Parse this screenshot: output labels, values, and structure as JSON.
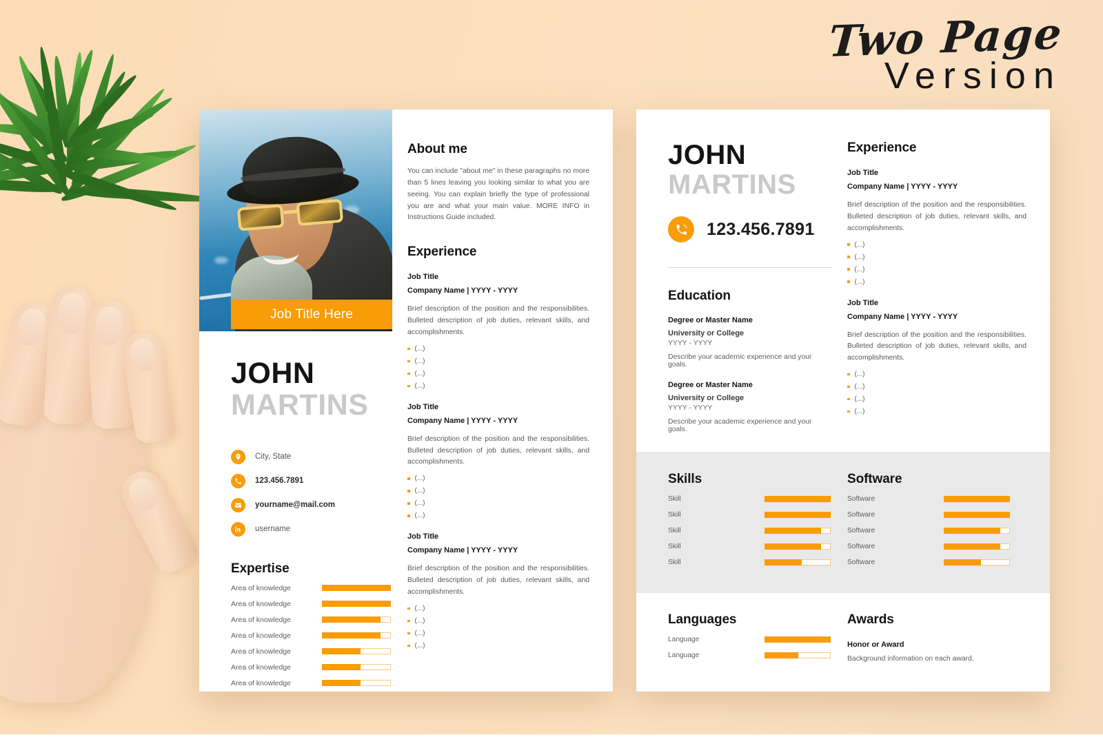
{
  "header": {
    "title_line1": "Two Page",
    "title_line2": "Version"
  },
  "page_one": {
    "photo_alt": "portrait-photo",
    "job_banner": "Job Title Here",
    "name_first": "JOHN",
    "name_last": "MARTINS",
    "contacts": [
      {
        "icon": "location-pin-icon",
        "text": "City, State",
        "bold": false
      },
      {
        "icon": "phone-icon",
        "text": "123.456.7891",
        "bold": true
      },
      {
        "icon": "envelope-icon",
        "text": "yourname@mail.com",
        "bold": true
      },
      {
        "icon": "linkedin-icon",
        "text": "username",
        "bold": false
      }
    ],
    "expertise": {
      "heading": "Expertise",
      "items": [
        {
          "label": "Area of knowledge",
          "value": 100
        },
        {
          "label": "Area of knowledge",
          "value": 100
        },
        {
          "label": "Area of knowledge",
          "value": 85
        },
        {
          "label": "Area of knowledge",
          "value": 85
        },
        {
          "label": "Area of knowledge",
          "value": 55
        },
        {
          "label": "Area of knowledge",
          "value": 55
        },
        {
          "label": "Area of knowledge",
          "value": 55
        }
      ]
    },
    "about": {
      "heading": "About me",
      "text": "You can include \"about me\" in these paragraphs no more than 5 lines leaving you looking similar to what you are seeing. You can explain briefly the type of professional you are and what your main value. MORE INFO in Instructions Guide included."
    },
    "experience": {
      "heading": "Experience",
      "entries": [
        {
          "title": "Job Title",
          "company": "Company Name | YYYY - YYYY",
          "description": "Brief description of the position and the responsibilities. Bulleted description of job duties, relevant skills, and accomplishments.",
          "bullets": [
            "(...)",
            "(...)",
            "(...)",
            "(...)"
          ]
        },
        {
          "title": "Job Title",
          "company": "Company Name | YYYY - YYYY",
          "description": "Brief description of the position and the responsibilities. Bulleted description of job duties, relevant skills, and accomplishments.",
          "bullets": [
            "(...)",
            "(...)",
            "(...)",
            "(...)"
          ]
        },
        {
          "title": "Job Title",
          "company": "Company Name | YYYY - YYYY",
          "description": "Brief description of the position and the responsibilities. Bulleted description of job duties, relevant skills, and accomplishments.",
          "bullets": [
            "(...)",
            "(...)",
            "(...)",
            "(...)"
          ]
        }
      ]
    }
  },
  "page_two": {
    "name_first": "JOHN",
    "name_last": "MARTINS",
    "phone_icon": "phone-icon",
    "phone": "123.456.7891",
    "education": {
      "heading": "Education",
      "entries": [
        {
          "degree": "Degree or Master Name",
          "school": "University or College",
          "years": "YYYY - YYYY",
          "description": "Describe your academic experience and your goals."
        },
        {
          "degree": "Degree or Master Name",
          "school": "University or College",
          "years": "YYYY - YYYY",
          "description": "Describe your academic experience and your goals."
        }
      ]
    },
    "experience": {
      "heading": "Experience",
      "entries": [
        {
          "title": "Job Title",
          "company": "Company Name | YYYY - YYYY",
          "description": "Brief description of the position and the responsibilities. Bulleted description of job duties, relevant skills, and accomplishments.",
          "bullets": [
            "(...)",
            "(...)",
            "(...)",
            "(...)"
          ]
        },
        {
          "title": "Job Title",
          "company": "Company Name | YYYY - YYYY",
          "description": "Brief description of the position and the responsibilities. Bulleted description of job duties, relevant skills, and accomplishments.",
          "bullets": [
            "(...)",
            "(...)",
            "(...)",
            "(...)"
          ]
        }
      ]
    },
    "skills": {
      "heading": "Skills",
      "items": [
        {
          "label": "Skill",
          "value": 100
        },
        {
          "label": "Skill",
          "value": 100
        },
        {
          "label": "Skill",
          "value": 85
        },
        {
          "label": "Skill",
          "value": 85
        },
        {
          "label": "Skill",
          "value": 55
        }
      ]
    },
    "software": {
      "heading": "Software",
      "items": [
        {
          "label": "Software",
          "value": 100
        },
        {
          "label": "Software",
          "value": 100
        },
        {
          "label": "Software",
          "value": 85
        },
        {
          "label": "Software",
          "value": 85
        },
        {
          "label": "Software",
          "value": 55
        }
      ]
    },
    "languages": {
      "heading": "Languages",
      "items": [
        {
          "label": "Language",
          "value": 100
        },
        {
          "label": "Language",
          "value": 50
        }
      ]
    },
    "awards": {
      "heading": "Awards",
      "title": "Honor or Award",
      "description": "Background information on each award."
    }
  },
  "colors": {
    "accent": "#f89c07",
    "background": "#fbdcb6",
    "band": "#e9e9e9",
    "name_gray": "#c9c9c9"
  }
}
